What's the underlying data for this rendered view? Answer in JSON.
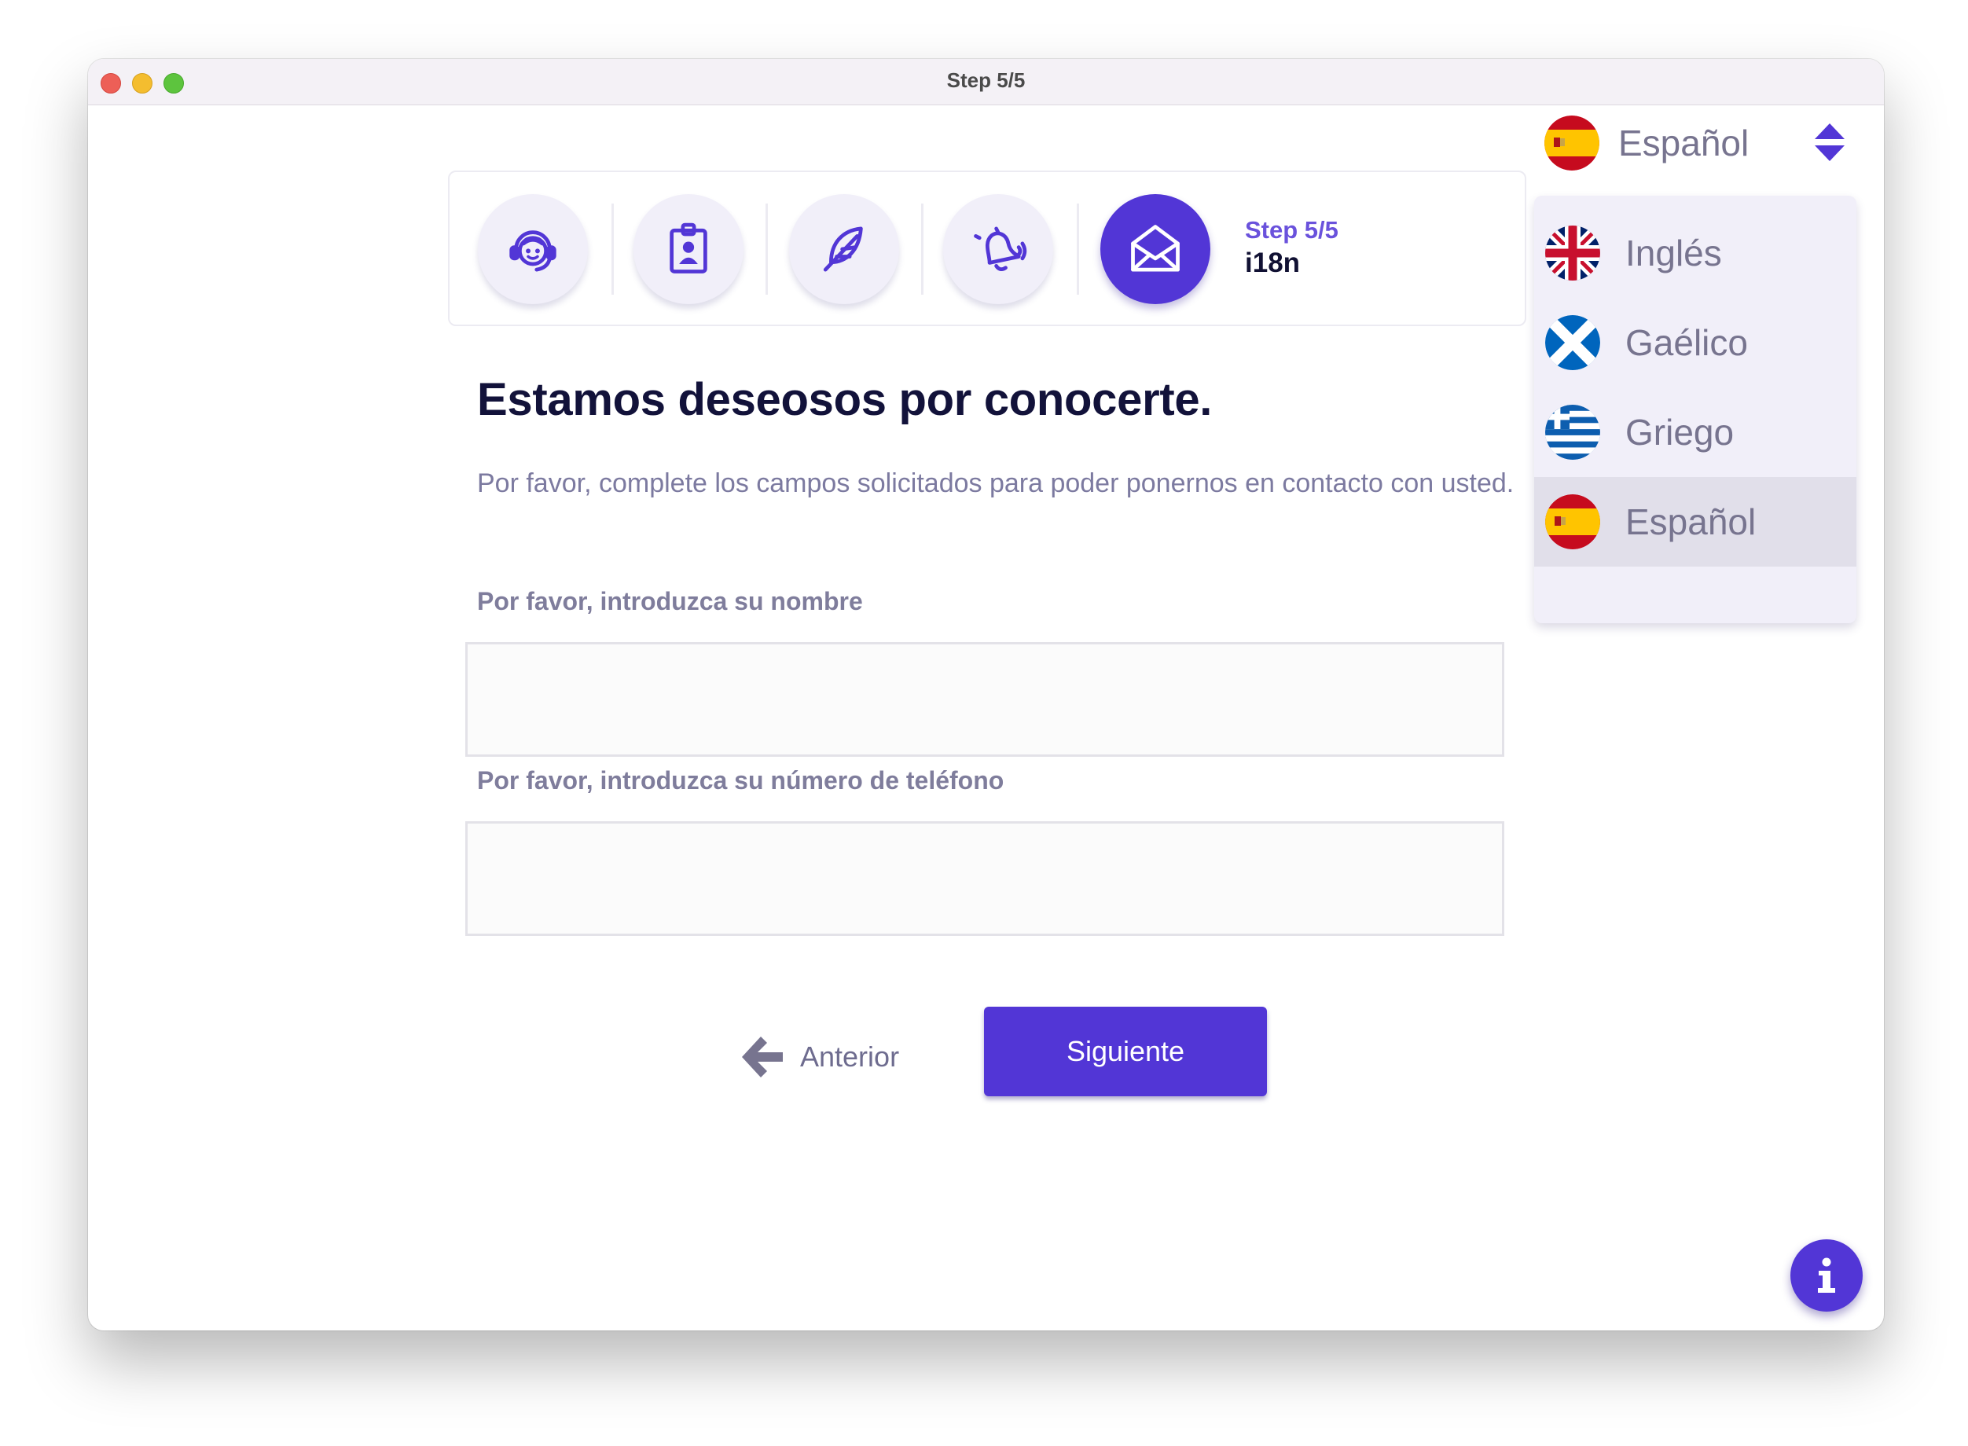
{
  "window": {
    "title": "Step 5/5"
  },
  "stepper": {
    "steps": [
      {
        "icon": "support-agent-icon"
      },
      {
        "icon": "id-badge-icon"
      },
      {
        "icon": "feather-icon"
      },
      {
        "icon": "bell-ringing-icon"
      },
      {
        "icon": "envelope-open-icon",
        "active": true
      }
    ],
    "current_step": "Step 5/5",
    "current_name": "i18n"
  },
  "form": {
    "heading": "Estamos deseosos por conocerte.",
    "description": "Por favor, complete los campos solicitados para poder ponernos en contacto con usted.",
    "name_label": "Por favor, introduzca su nombre",
    "name_value": "",
    "phone_label": "Por favor, introduzca su número de teléfono",
    "phone_value": ""
  },
  "nav": {
    "back_label": "Anterior",
    "next_label": "Siguiente"
  },
  "language": {
    "current": "Español",
    "options": [
      {
        "name": "Inglés",
        "flag": "uk-flag-icon"
      },
      {
        "name": "Gaélico",
        "flag": "scotland-flag-icon"
      },
      {
        "name": "Griego",
        "flag": "greece-flag-icon"
      },
      {
        "name": "Español",
        "flag": "spain-flag-icon",
        "selected": true
      }
    ]
  },
  "colors": {
    "accent": "#5236d6",
    "text_dark": "#12123a",
    "text_muted": "#7c7aa0"
  }
}
